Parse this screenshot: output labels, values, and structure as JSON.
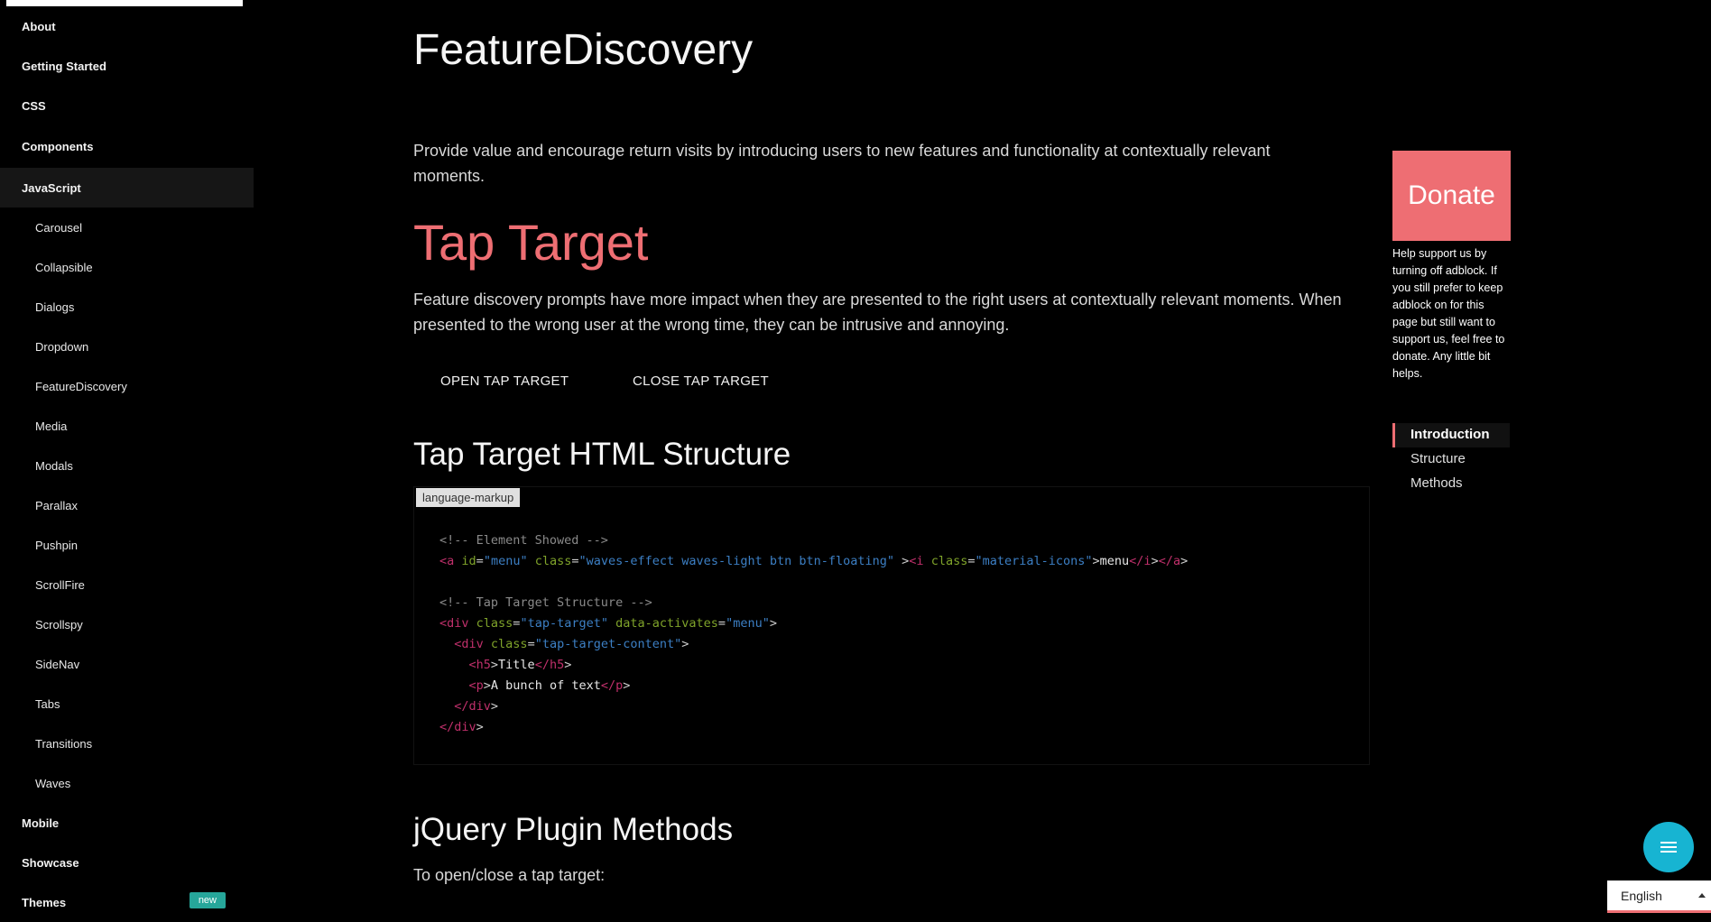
{
  "sidebar": {
    "items": [
      {
        "label": "About"
      },
      {
        "label": "Getting Started"
      },
      {
        "label": "CSS"
      },
      {
        "label": "Components"
      },
      {
        "label": "JavaScript"
      }
    ],
    "sub_items": [
      {
        "label": "Carousel"
      },
      {
        "label": "Collapsible"
      },
      {
        "label": "Dialogs"
      },
      {
        "label": "Dropdown"
      },
      {
        "label": "FeatureDiscovery"
      },
      {
        "label": "Media"
      },
      {
        "label": "Modals"
      },
      {
        "label": "Parallax"
      },
      {
        "label": "Pushpin"
      },
      {
        "label": "ScrollFire"
      },
      {
        "label": "Scrollspy"
      },
      {
        "label": "SideNav"
      },
      {
        "label": "Tabs"
      },
      {
        "label": "Transitions"
      },
      {
        "label": "Waves"
      }
    ],
    "bottom_items": [
      {
        "label": "Mobile"
      },
      {
        "label": "Showcase"
      },
      {
        "label": "Themes",
        "badge": "new"
      }
    ]
  },
  "main": {
    "title": "FeatureDiscovery",
    "intro": "Provide value and encourage return visits by introducing users to new features and functionality at contextually relevant moments.",
    "section_title": "Tap Target",
    "description": "Feature discovery prompts have more impact when they are presented to the right users at contextually relevant moments. When presented to the wrong user at the wrong time, they can be intrusive and annoying.",
    "buttons": {
      "open": "OPEN TAP TARGET",
      "close": "CLOSE TAP TARGET"
    },
    "structure_heading": "Tap Target HTML Structure",
    "code_language": "language-markup",
    "code": {
      "comment1": "<!-- Element Showed -->",
      "comment2": "<!-- Tap Target Structure -->",
      "menu_text": "menu",
      "title_text": "Title",
      "body_text": "A bunch of text"
    },
    "methods_heading": "jQuery Plugin Methods",
    "methods_intro": "To open/close a tap target:"
  },
  "aside": {
    "donate_label": "Donate",
    "donate_text": "Help support us by turning off adblock. If you still prefer to keep adblock on for this page but still want to support us, feel free to donate. Any little bit helps.",
    "toc": [
      {
        "label": "Introduction",
        "active": true
      },
      {
        "label": "Structure"
      },
      {
        "label": "Methods"
      }
    ]
  },
  "language_select": {
    "value": "English"
  },
  "colors": {
    "accent": "#ee6e73",
    "fab": "#17b4d2",
    "badge": "#26a69a"
  }
}
